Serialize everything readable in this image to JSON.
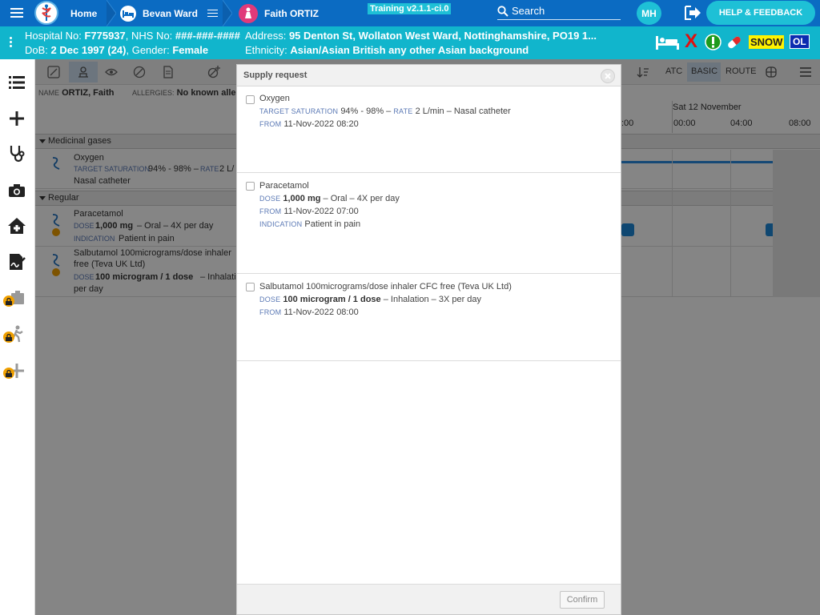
{
  "nav": {
    "home_label": "Home",
    "ward_label": "Bevan Ward",
    "patient_label": "Faith ORTIZ",
    "training_tag": "Training v2.1.1-ci.0",
    "search_placeholder": "Search",
    "user_initials": "MH",
    "help_label": "HELP & FEEDBACK"
  },
  "banner": {
    "hospital_no_label": "Hospital No:",
    "hospital_no": "F775937",
    "nhs_no_label": "NHS No:",
    "nhs_no": "###-###-####",
    "dob_label": "DoB:",
    "dob": "2 Dec 1997 (24)",
    "gender_label": "Gender:",
    "gender": "Female",
    "address_label": "Address:",
    "address": "95 Denton St, Wollaton West Ward, Nottinghamshire, PO19 1...",
    "ethnicity_label": "Ethnicity:",
    "ethnicity": "Asian/Asian British any other Asian background",
    "alert_x": "X",
    "snow_badge": "SNOW",
    "ol_badge": "OL"
  },
  "toolbar": {
    "atc_label": "ATC",
    "basic_label": "BASIC",
    "route_label": "ROUTE"
  },
  "patient_header": {
    "name_label": "NAME",
    "name": "ORTIZ, Faith",
    "allergies_label": "ALLERGIES:",
    "allergies": "No known allerg"
  },
  "chart_header": {
    "day_label": "Sat 12 November",
    "times": [
      ":00",
      "00:00",
      "04:00",
      "08:00"
    ]
  },
  "background_sections": {
    "gases_label": "Medicinal gases",
    "regular_label": "Regular",
    "oxygen_name": "Oxygen",
    "oxygen_target_key": "TARGET SATURATION",
    "oxygen_target": "94% - 98% –",
    "oxygen_rate_key": "RATE",
    "oxygen_rate": "2 L/",
    "oxygen_device": "Nasal catheter",
    "paracetamol_name": "Paracetamol",
    "paracetamol_dose_key": "DOSE",
    "paracetamol_dose": "1,000 mg",
    "paracetamol_route": "– Oral – 4X per day",
    "paracetamol_indication_key": "INDICATION",
    "paracetamol_indication": "Patient in pain",
    "salbutamol_name_1": "Salbutamol 100micrograms/dose inhaler",
    "salbutamol_name_2": "free (Teva UK Ltd)",
    "salbutamol_dose_key": "DOSE",
    "salbutamol_dose": "100 microgram / 1 dose",
    "salbutamol_route": "– Inhalatio",
    "salbutamol_freq": "per day"
  },
  "modal": {
    "title": "Supply request",
    "confirm_label": "Confirm",
    "items": [
      {
        "name": "Oxygen",
        "target_key": "TARGET SATURATION",
        "target": "94% - 98% –",
        "rate_key": "RATE",
        "rate": "2 L/min – Nasal catheter",
        "from_key": "FROM",
        "from": "11-Nov-2022 08:20"
      },
      {
        "name": "Paracetamol",
        "dose_key": "DOSE",
        "dose": "1,000 mg",
        "route": "– Oral – 4X per day",
        "from_key": "FROM",
        "from": "11-Nov-2022 07:00",
        "indication_key": "INDICATION",
        "indication": "Patient in pain"
      },
      {
        "name": "Salbutamol 100micrograms/dose inhaler CFC free (Teva UK Ltd)",
        "dose_key": "DOSE",
        "dose": "100 microgram / 1 dose",
        "route": "– Inhalation – 3X per day",
        "from_key": "FROM",
        "from": "11-Nov-2022 08:00"
      }
    ]
  },
  "colors": {
    "topbar": "#0b6bc2",
    "banner": "#11b5cc",
    "accent": "#1ec0d6",
    "lock": "#f0a000",
    "dose_marker": "#1e88d8"
  }
}
